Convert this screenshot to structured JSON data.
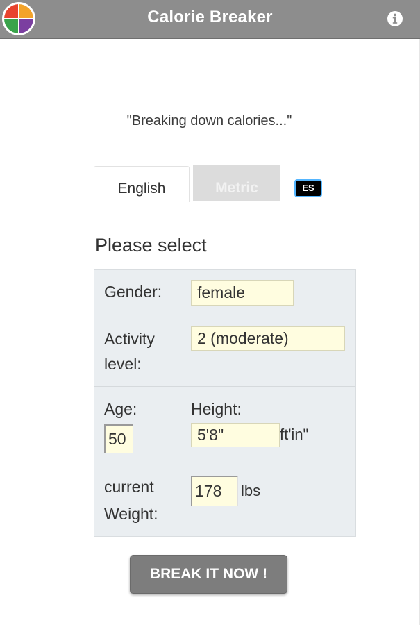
{
  "app": {
    "title": "Calorie Breaker",
    "logo_icon": "color-wheel-logo",
    "info_icon": "info-icon"
  },
  "tagline": "\"Breaking down calories...\"",
  "tabs": [
    {
      "label": "English",
      "active": true
    },
    {
      "label": "Metric",
      "active": false
    }
  ],
  "language_badge": "ES",
  "form": {
    "heading": "Please select",
    "gender": {
      "label": "Gender:",
      "value": "female"
    },
    "activity": {
      "label_line1": "Activity",
      "label_line2": "level:",
      "value": "2 (moderate)"
    },
    "age": {
      "label": "Age:",
      "value": "50"
    },
    "height": {
      "label": "Height:",
      "value": "5'8\"",
      "unit": "ft'in\""
    },
    "weight": {
      "label_line1": "current",
      "label_line2": "Weight:",
      "value": "178",
      "unit": "lbs"
    }
  },
  "submit_label": "BREAK IT NOW !",
  "colors": {
    "header_bg": "#8d8d8d",
    "panel_bg": "#eaeef1",
    "field_bg": "#fffde0",
    "button_bg": "#7d7d7d",
    "badge_border": "#55b6ff",
    "logo": [
      "#e8432e",
      "#f3a32a",
      "#3aa34b",
      "#7b3fa0"
    ]
  }
}
